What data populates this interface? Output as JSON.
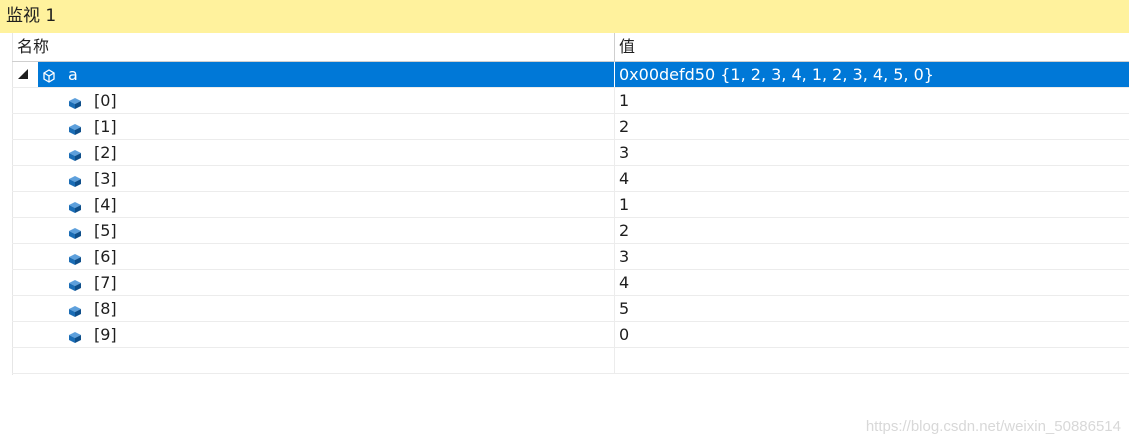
{
  "panel": {
    "title": "监视 1"
  },
  "header": {
    "name": "名称",
    "value": "值"
  },
  "root": {
    "name": "a",
    "value": "0x00defd50 {1, 2, 3, 4, 1, 2, 3, 4, 5, 0}",
    "icon": "object-icon"
  },
  "items": [
    {
      "name": "[0]",
      "value": "1"
    },
    {
      "name": "[1]",
      "value": "2"
    },
    {
      "name": "[2]",
      "value": "3"
    },
    {
      "name": "[3]",
      "value": "4"
    },
    {
      "name": "[4]",
      "value": "1"
    },
    {
      "name": "[5]",
      "value": "2"
    },
    {
      "name": "[6]",
      "value": "3"
    },
    {
      "name": "[7]",
      "value": "4"
    },
    {
      "name": "[8]",
      "value": "5"
    },
    {
      "name": "[9]",
      "value": "0"
    }
  ],
  "item_icon": "field-icon",
  "watermark": "https://blog.csdn.net/weixin_50886514",
  "colors": {
    "title_bg": "#fff29d",
    "selection": "#0078d7",
    "field_icon": "#1b6db5"
  }
}
